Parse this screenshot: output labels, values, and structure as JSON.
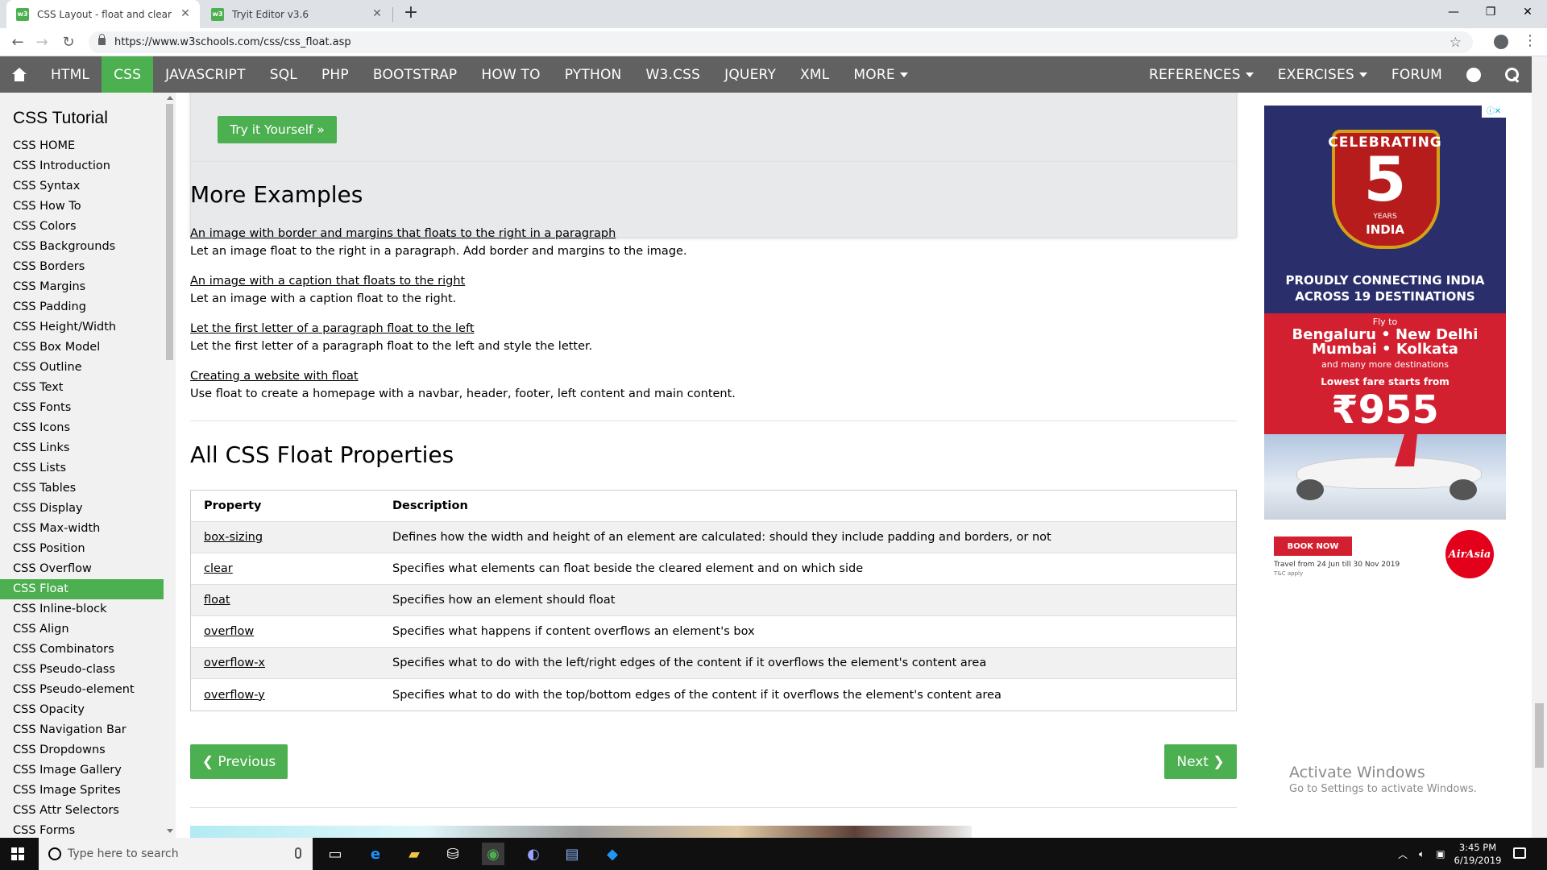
{
  "browser": {
    "tabs": [
      {
        "title": "CSS Layout - float and clear",
        "favicon": "w3"
      },
      {
        "title": "Tryit Editor v3.6",
        "favicon": "w3"
      }
    ],
    "url": "https://www.w3schools.com/css/css_float.asp"
  },
  "topnav": {
    "items": [
      "HTML",
      "CSS",
      "JAVASCRIPT",
      "SQL",
      "PHP",
      "BOOTSTRAP",
      "HOW TO",
      "PYTHON",
      "W3.CSS",
      "JQUERY",
      "XML",
      "MORE"
    ],
    "active": "CSS",
    "right_items": [
      "REFERENCES",
      "EXERCISES",
      "FORUM"
    ]
  },
  "sidebar": {
    "title": "CSS Tutorial",
    "items": [
      "CSS HOME",
      "CSS Introduction",
      "CSS Syntax",
      "CSS How To",
      "CSS Colors",
      "CSS Backgrounds",
      "CSS Borders",
      "CSS Margins",
      "CSS Padding",
      "CSS Height/Width",
      "CSS Box Model",
      "CSS Outline",
      "CSS Text",
      "CSS Fonts",
      "CSS Icons",
      "CSS Links",
      "CSS Lists",
      "CSS Tables",
      "CSS Display",
      "CSS Max-width",
      "CSS Position",
      "CSS Overflow",
      "CSS Float",
      "CSS Inline-block",
      "CSS Align",
      "CSS Combinators",
      "CSS Pseudo-class",
      "CSS Pseudo-element",
      "CSS Opacity",
      "CSS Navigation Bar",
      "CSS Dropdowns",
      "CSS Image Gallery",
      "CSS Image Sprites",
      "CSS Attr Selectors",
      "CSS Forms"
    ],
    "active": "CSS Float"
  },
  "main": {
    "try_button": "Try it Yourself »",
    "more_examples_title": "More Examples",
    "examples": [
      {
        "link": "An image with border and margins that floats to the right in a paragraph",
        "desc": "Let an image float to the right in a paragraph. Add border and margins to the image."
      },
      {
        "link": "An image with a caption that floats to the right",
        "desc": "Let an image with a caption float to the right."
      },
      {
        "link": "Let the first letter of a paragraph float to the left",
        "desc": "Let the first letter of a paragraph float to the left and style the letter."
      },
      {
        "link": "Creating a website with float",
        "desc": "Use float to create a homepage with a navbar, header, footer, left content and main content."
      }
    ],
    "properties_title": "All CSS Float Properties",
    "table": {
      "headers": [
        "Property",
        "Description"
      ],
      "rows": [
        {
          "property": "box-sizing",
          "description": "Defines how the width and height of an element are calculated: should they include padding and borders, or not"
        },
        {
          "property": "clear",
          "description": "Specifies what elements can float beside the cleared element and on which side"
        },
        {
          "property": "float",
          "description": "Specifies how an element should float"
        },
        {
          "property": "overflow",
          "description": "Specifies what happens if content overflows an element's box"
        },
        {
          "property": "overflow-x",
          "description": "Specifies what to do with the left/right edges of the content if it overflows the element's content area"
        },
        {
          "property": "overflow-y",
          "description": "Specifies what to do with the top/bottom edges of the content if it overflows the element's content area"
        }
      ]
    },
    "prev_button": "❮ Previous",
    "next_button": "Next ❯"
  },
  "ad": {
    "celebrating": "CELEBRATING",
    "number": "5",
    "years": "YEARS",
    "india": "INDIA",
    "proudly": "PROUDLY CONNECTING INDIA ACROSS 19 DESTINATIONS",
    "fly_to": "Fly to",
    "cities_line1": "Bengaluru • New Delhi",
    "cities_line2": "Mumbai • Kolkata",
    "more_destinations": "and many more destinations",
    "lowest_fare": "Lowest fare starts from",
    "price": "₹955",
    "book_now": "BOOK NOW",
    "travel_dates": "Travel from 24 Jun till 30 Nov 2019",
    "tc": "T&C apply",
    "brand": "AirAsia"
  },
  "watermark": {
    "line1": "Activate Windows",
    "line2": "Go to Settings to activate Windows."
  },
  "taskbar": {
    "search_placeholder": "Type here to search",
    "time": "3:45 PM",
    "date": "6/19/2019"
  },
  "colors": {
    "w3_green": "#4caf50",
    "nav_gray": "#616161",
    "sidebar_bg": "#f1f1f1"
  }
}
